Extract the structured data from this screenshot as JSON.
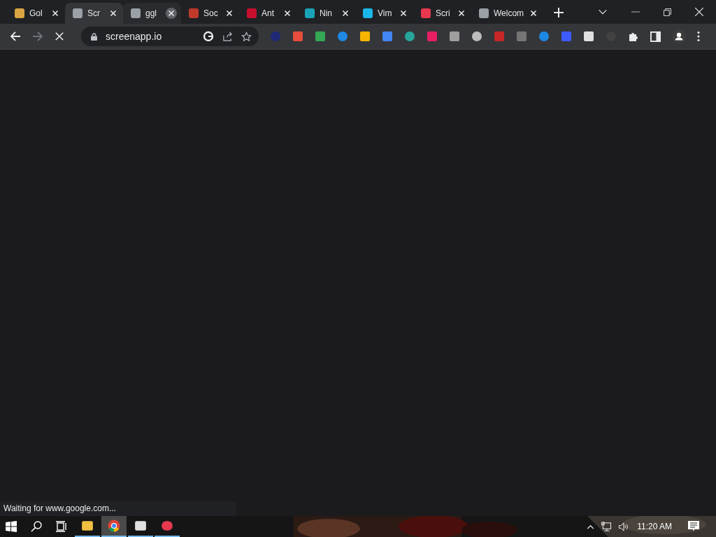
{
  "tabs": [
    {
      "title": "Gol",
      "selected": false,
      "hovered": false,
      "color": "#d9a441"
    },
    {
      "title": "Scr",
      "selected": true,
      "hovered": false,
      "color": "#9aa0a6"
    },
    {
      "title": "ggl",
      "selected": false,
      "hovered": true,
      "color": "#9aa0a6"
    },
    {
      "title": "Soc",
      "selected": false,
      "hovered": false,
      "color": "#c0392b"
    },
    {
      "title": "Ant",
      "selected": false,
      "hovered": false,
      "color": "#c8102e"
    },
    {
      "title": "Nin",
      "selected": false,
      "hovered": false,
      "color": "#1aa3b8"
    },
    {
      "title": "Vim",
      "selected": false,
      "hovered": false,
      "color": "#1ab7ea"
    },
    {
      "title": "Scri",
      "selected": false,
      "hovered": false,
      "color": "#e8384f"
    },
    {
      "title": "Welcom",
      "selected": false,
      "hovered": false,
      "color": "#9aa0a6"
    }
  ],
  "toolbar": {
    "url": "screenapp.io",
    "loading": true
  },
  "status_bubble": "Waiting for www.google.com...",
  "taskbar": {
    "apps": [
      {
        "selected": false,
        "running": true
      },
      {
        "selected": true,
        "running": true
      },
      {
        "selected": false,
        "running": true
      },
      {
        "selected": false,
        "running": true
      }
    ],
    "clock": "11:20 AM"
  }
}
